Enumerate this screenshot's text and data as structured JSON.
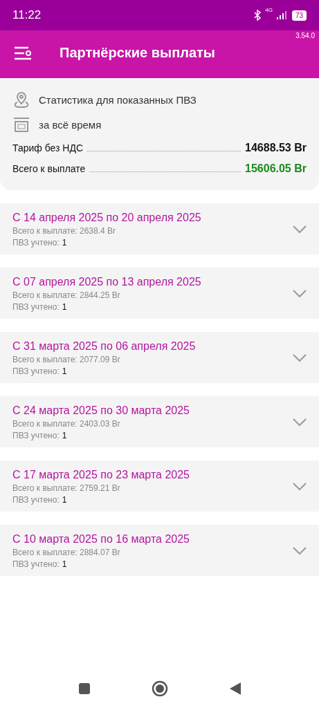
{
  "status_bar": {
    "time": "11:22",
    "network": "4G",
    "battery": "73"
  },
  "header": {
    "version": "3.54.0",
    "title": "Партнёрские выплаты"
  },
  "summary": {
    "filter_lines": [
      {
        "kind": "location",
        "text": "Статистика для показанных ПВЗ"
      },
      {
        "kind": "store",
        "text": "за всё время"
      }
    ],
    "totals": [
      {
        "label": "Тариф без НДС",
        "value": "14688.53 Br",
        "color": "#111111"
      },
      {
        "label": "Всего к выплате",
        "value": "15606.05 Br",
        "color": "#1a8a1a"
      }
    ]
  },
  "periods": [
    {
      "title": "С 14 апреля 2025 по 20 апреля 2025",
      "total": "Всего к выплате: 2638.4 Br",
      "count_label": "ПВЗ учтено:",
      "count": "1",
      "expanded": false
    },
    {
      "title": "С 07 апреля 2025 по 13 апреля 2025",
      "total": "Всего к выплате: 2844.25 Br",
      "count_label": "ПВЗ учтено:",
      "count": "1",
      "expanded": false
    },
    {
      "title": "С 31 марта 2025 по 06 апреля 2025",
      "total": "Всего к выплате: 2077.09 Br",
      "count_label": "ПВЗ учтено:",
      "count": "1",
      "expanded": false
    },
    {
      "title": "С 24 марта 2025 по 30 марта 2025",
      "total": "Всего к выплате: 2403.03 Br",
      "count_label": "ПВЗ учтено:",
      "count": "1",
      "expanded": false
    },
    {
      "title": "С 17 марта 2025 по 23 марта 2025",
      "total": "Всего к выплате: 2759.21 Br",
      "count_label": "ПВЗ учтено:",
      "count": "1",
      "expanded": false
    },
    {
      "title": "С 10 марта 2025 по 16 марта 2025",
      "total": "Всего к выплате: 2884.07 Br",
      "count_label": "ПВЗ учтено:",
      "count": "1",
      "expanded": false
    }
  ]
}
